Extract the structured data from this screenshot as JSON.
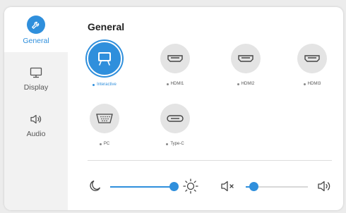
{
  "sidebar": {
    "items": [
      {
        "label": "General",
        "icon": "wrench-icon",
        "active": true
      },
      {
        "label": "Display",
        "icon": "monitor-icon",
        "active": false
      },
      {
        "label": "Audio",
        "icon": "speaker-icon",
        "active": false
      }
    ]
  },
  "main": {
    "title": "General",
    "sources": [
      {
        "label": "Interactive",
        "icon": "interactive-display-icon",
        "active": true
      },
      {
        "label": "HDMI1",
        "icon": "hdmi-port-icon",
        "active": false
      },
      {
        "label": "HDMI2",
        "icon": "hdmi-port-icon",
        "active": false
      },
      {
        "label": "HDMI3",
        "icon": "hdmi-port-icon",
        "active": false
      },
      {
        "label": "PC",
        "icon": "vga-port-icon",
        "active": false
      },
      {
        "label": "Type-C",
        "icon": "usb-c-port-icon",
        "active": false
      }
    ]
  },
  "controls": {
    "brightness": {
      "level": 1.0,
      "low_icon": "moon-icon",
      "high_icon": "sun-icon"
    },
    "volume": {
      "level": 0.12,
      "low_icon": "mute-icon",
      "high_icon": "volume-icon"
    }
  },
  "colors": {
    "accent": "#2f8fdc",
    "sidebar_bg": "#f2f2f2",
    "circle_bg": "#e4e4e4"
  }
}
